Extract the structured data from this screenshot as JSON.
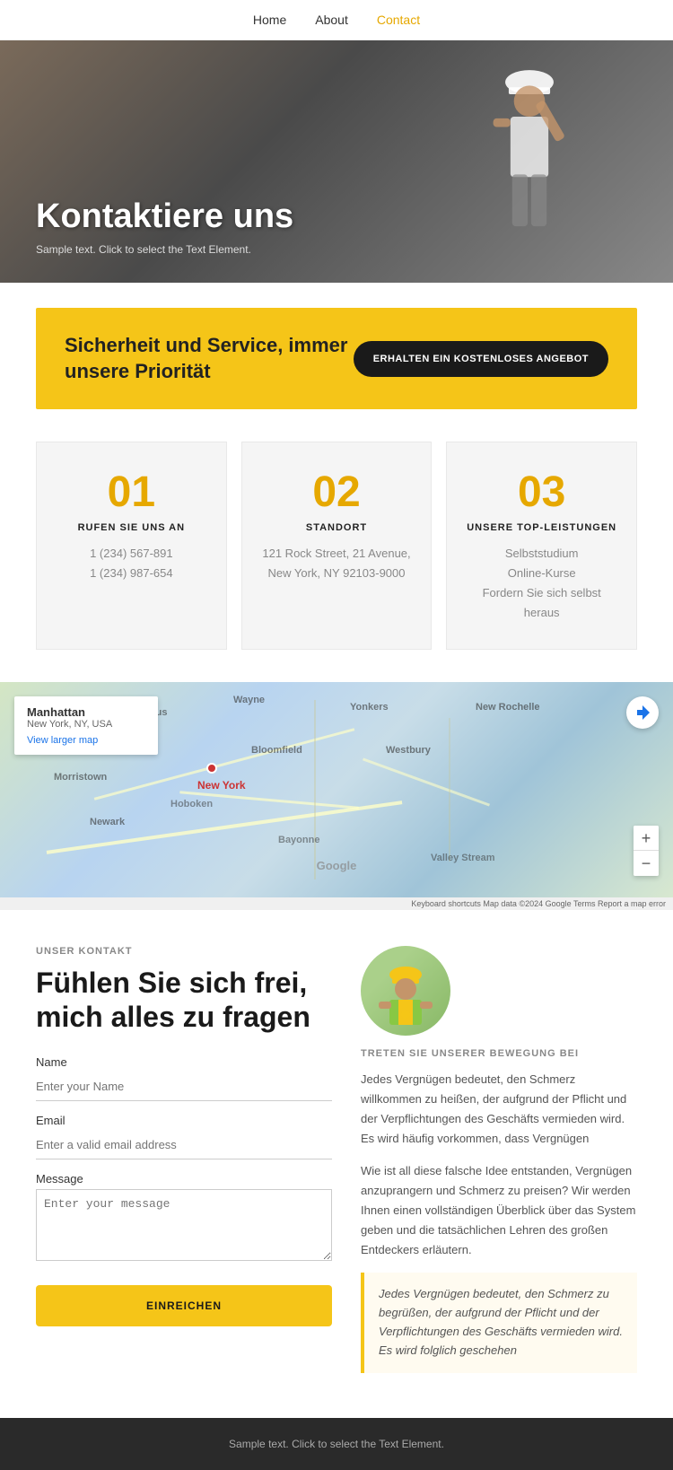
{
  "nav": {
    "links": [
      {
        "label": "Home",
        "href": "#",
        "active": false
      },
      {
        "label": "About",
        "href": "#",
        "active": false
      },
      {
        "label": "Contact",
        "href": "#",
        "active": true
      }
    ]
  },
  "hero": {
    "title": "Kontaktiere uns",
    "subtitle": "Sample text. Click to select the Text Element."
  },
  "banner": {
    "text": "Sicherheit und Service, immer unsere Priorität",
    "button_label": "ERHALTEN EIN KOSTENLOSES ANGEBOT"
  },
  "info_cards": [
    {
      "number": "01",
      "title": "RUFEN SIE UNS AN",
      "lines": [
        "1 (234) 567-891",
        "1 (234) 987-654"
      ]
    },
    {
      "number": "02",
      "title": "STANDORT",
      "lines": [
        "121 Rock Street, 21 Avenue,",
        "New York, NY 92103-9000"
      ]
    },
    {
      "number": "03",
      "title": "UNSERE TOP-LEISTUNGEN",
      "lines": [
        "Selbststudium",
        "Online-Kurse",
        "Fordern Sie sich selbst heraus"
      ]
    }
  ],
  "map": {
    "location_title": "Manhattan",
    "location_sub": "New York, NY, USA",
    "directions_label": "Directions",
    "larger_map_label": "View larger map",
    "footer_text": "Keyboard shortcuts   Map data ©2024 Google   Terms   Report a map error"
  },
  "contact": {
    "section_label": "UNSER KONTAKT",
    "heading": "Fühlen Sie sich frei, mich alles zu fragen",
    "form": {
      "name_label": "Name",
      "name_placeholder": "Enter your Name",
      "email_label": "Email",
      "email_placeholder": "Enter a valid email address",
      "message_label": "Message",
      "message_placeholder": "Enter your message",
      "submit_label": "EINREICHEN"
    },
    "right": {
      "join_label": "TRETEN SIE UNSERER BEWEGUNG BEI",
      "para1": "Jedes Vergnügen bedeutet, den Schmerz willkommen zu heißen, der aufgrund der Pflicht und der Verpflichtungen des Geschäfts vermieden wird. Es wird häufig vorkommen, dass Vergnügen",
      "para2": "Wie ist all diese falsche Idee entstanden, Vergnügen anzuprangern und Schmerz zu preisen? Wir werden Ihnen einen vollständigen Überblick über das System geben und die tatsächlichen Lehren des großen Entdeckers erläutern.",
      "quote": "Jedes Vergnügen bedeutet, den Schmerz zu begrüßen, der aufgrund der Pflicht und der Verpflichtungen des Geschäfts vermieden wird. Es wird folglich geschehen"
    }
  },
  "footer": {
    "text": "Sample text. Click to select the Text Element."
  }
}
